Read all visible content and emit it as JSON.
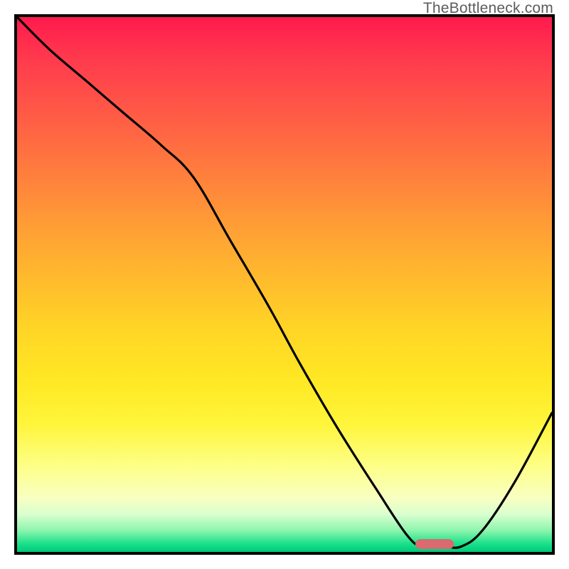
{
  "attribution": "TheBottleneck.com",
  "marker_color": "#d96a6f",
  "chart_data": {
    "type": "line",
    "title": "",
    "xlabel": "",
    "ylabel": "",
    "xlim": [
      0,
      100
    ],
    "ylim": [
      0,
      100
    ],
    "series": [
      {
        "name": "curve",
        "x": [
          0,
          6,
          13,
          20,
          27,
          33,
          40,
          47,
          53,
          60,
          67,
          73,
          76,
          80,
          83,
          87,
          93,
          100
        ],
        "y": [
          100,
          94,
          88,
          82,
          76,
          70,
          58,
          46,
          35,
          23,
          12,
          3,
          1,
          1,
          1,
          4,
          13,
          26
        ]
      }
    ],
    "marker": {
      "x": 78,
      "y": 1.5
    },
    "gradient_stops": [
      {
        "pos": 0.0,
        "color": "#ff1a4d"
      },
      {
        "pos": 0.5,
        "color": "#ffc628"
      },
      {
        "pos": 0.85,
        "color": "#feff88"
      },
      {
        "pos": 1.0,
        "color": "#00c878"
      }
    ]
  }
}
